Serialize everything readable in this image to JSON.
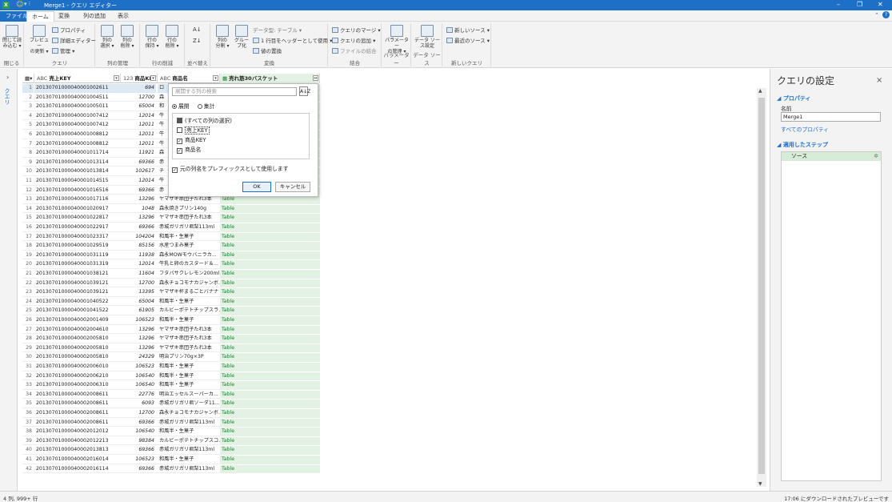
{
  "titlebar": {
    "app_logo": "X",
    "title": "Merge1 - クエリ エディター",
    "qa_text": "▾ ⁝"
  },
  "tabs": [
    "ファイル",
    "ホーム",
    "変換",
    "列の追加",
    "表示"
  ],
  "ribbon": {
    "close_load": "閉じて読\nみ込む ▾",
    "preview_refresh": "プレビュー\nの更新 ▾",
    "properties": "プロパティ",
    "advanced_editor": "詳細エディター",
    "manage": "管理 ▾",
    "query_group": "クエリ",
    "close_group": "閉じる",
    "choose_cols": "列の\n選択 ▾",
    "remove_cols": "列の\n削除 ▾",
    "manage_cols_group": "列の管理",
    "keep_rows": "行の\n保持 ▾",
    "remove_rows": "行の\n削除 ▾",
    "reduce_rows_group": "行の削減",
    "sort_group": "並べ替え",
    "split_col": "列の\n分割 ▾",
    "group_by": "グルー\nプ化",
    "datatype": "データ型: テーブル ▾",
    "first_row_header": "1 行目をヘッダーとして使用 ▾",
    "replace_values": "値の置換",
    "transform_group": "変換",
    "merge_queries": "クエリのマージ ▾",
    "append_queries": "クエリの追加 ▾",
    "combine_files": "ファイルの結合",
    "combine_group": "結合",
    "param_manage": "パラメーター\nの管理 ▾",
    "param_group": "パラメーター",
    "datasource_settings": "データ ソー\nス設定",
    "datasource_group": "データ ソース",
    "new_source": "新しいソース ▾",
    "recent_source": "最近のソース ▾",
    "new_query_group": "新しいクエリ"
  },
  "leftnav": {
    "chevron": "›",
    "label": "クエリ"
  },
  "grid": {
    "headers": [
      {
        "icon": "ABC",
        "label": "売上KEY"
      },
      {
        "icon": "123",
        "label": "商品KEY"
      },
      {
        "icon": "ABC",
        "label": "商品名"
      },
      {
        "icon": "▦",
        "label": "売れ筋30バスケット"
      }
    ],
    "rows": [
      {
        "n": "1",
        "key": "20130701000040001002611",
        "pk": "694",
        "name": "ロ",
        "tbl": ""
      },
      {
        "n": "2",
        "key": "20130701000040001004511",
        "pk": "12700",
        "name": "森",
        "tbl": ""
      },
      {
        "n": "3",
        "key": "20130701000040001005011",
        "pk": "65004",
        "name": "和",
        "tbl": ""
      },
      {
        "n": "4",
        "key": "20130701000040001007412",
        "pk": "12014",
        "name": "牛",
        "tbl": ""
      },
      {
        "n": "5",
        "key": "20130701000040001007412",
        "pk": "12011",
        "name": "牛",
        "tbl": ""
      },
      {
        "n": "6",
        "key": "20130701000040001008812",
        "pk": "12011",
        "name": "牛",
        "tbl": ""
      },
      {
        "n": "7",
        "key": "20130701000040001008812",
        "pk": "12011",
        "name": "牛",
        "tbl": ""
      },
      {
        "n": "8",
        "key": "20130701000040001011714",
        "pk": "11921",
        "name": "森",
        "tbl": ""
      },
      {
        "n": "9",
        "key": "20130701000040001013114",
        "pk": "69366",
        "name": "赤",
        "tbl": ""
      },
      {
        "n": "10",
        "key": "20130701000040001013814",
        "pk": "102617",
        "name": "チ",
        "tbl": ""
      },
      {
        "n": "11",
        "key": "20130701000040001014515",
        "pk": "12014",
        "name": "牛",
        "tbl": ""
      },
      {
        "n": "12",
        "key": "20130701000040001016516",
        "pk": "69366",
        "name": "赤",
        "tbl": ""
      },
      {
        "n": "13",
        "key": "20130701000040001017116",
        "pk": "13296",
        "name": "ヤマザキ串団子たれ3本",
        "tbl": "Table"
      },
      {
        "n": "14",
        "key": "20130701000040001020917",
        "pk": "1048",
        "name": "森永焼きプリン140g",
        "tbl": "Table"
      },
      {
        "n": "15",
        "key": "20130701000040001022817",
        "pk": "13296",
        "name": "ヤマザキ串団子たれ3本",
        "tbl": "Table"
      },
      {
        "n": "16",
        "key": "20130701000040001022917",
        "pk": "69366",
        "name": "赤城ガリガリ君梨113ml",
        "tbl": "Table"
      },
      {
        "n": "17",
        "key": "20130701000040001023317",
        "pk": "104204",
        "name": "和風半・生菓子",
        "tbl": "Table"
      },
      {
        "n": "18",
        "key": "20130701000040001029519",
        "pk": "85156",
        "name": "水産つまみ菓子",
        "tbl": "Table"
      },
      {
        "n": "19",
        "key": "20130701000040001031119",
        "pk": "11938",
        "name": "森永MOWモウバニラカ...",
        "tbl": "Table"
      },
      {
        "n": "20",
        "key": "20130701000040001031319",
        "pk": "12014",
        "name": "牛乳と卵のカスタード＆...",
        "tbl": "Table"
      },
      {
        "n": "21",
        "key": "20130701000040001038121",
        "pk": "11604",
        "name": "フタバサクレレモン200ml",
        "tbl": "Table"
      },
      {
        "n": "22",
        "key": "20130701000040001039121",
        "pk": "12700",
        "name": "森永チョコモナカジャンボ...",
        "tbl": "Table"
      },
      {
        "n": "23",
        "key": "20130701000040001039121",
        "pk": "13395",
        "name": "ヤマザキ杯まるごとバナナ",
        "tbl": "Table"
      },
      {
        "n": "24",
        "key": "20130701000040001040522",
        "pk": "65004",
        "name": "和風半・生菓子",
        "tbl": "Table"
      },
      {
        "n": "25",
        "key": "20130701000040001041522",
        "pk": "61905",
        "name": "カルビーポテトチップスラ...",
        "tbl": "Table"
      },
      {
        "n": "26",
        "key": "20130701000040002001409",
        "pk": "106523",
        "name": "和風半・生菓子",
        "tbl": "Table"
      },
      {
        "n": "27",
        "key": "20130701000040002004610",
        "pk": "13296",
        "name": "ヤマザキ串団子たれ3本",
        "tbl": "Table"
      },
      {
        "n": "28",
        "key": "20130701000040002005810",
        "pk": "13296",
        "name": "ヤマザキ串団子たれ3本",
        "tbl": "Table"
      },
      {
        "n": "29",
        "key": "20130701000040002005810",
        "pk": "13296",
        "name": "ヤマザキ串団子たれ3本",
        "tbl": "Table"
      },
      {
        "n": "30",
        "key": "20130701000040002005810",
        "pk": "24329",
        "name": "明治プリン70g×3P",
        "tbl": "Table"
      },
      {
        "n": "31",
        "key": "20130701000040002006010",
        "pk": "106523",
        "name": "和風半・生菓子",
        "tbl": "Table"
      },
      {
        "n": "32",
        "key": "20130701000040002006210",
        "pk": "106540",
        "name": "和風半・生菓子",
        "tbl": "Table"
      },
      {
        "n": "33",
        "key": "20130701000040002006310",
        "pk": "106540",
        "name": "和風半・生菓子",
        "tbl": "Table"
      },
      {
        "n": "34",
        "key": "20130701000040002008611",
        "pk": "22776",
        "name": "明治エッセルスーパーカ...",
        "tbl": "Table"
      },
      {
        "n": "35",
        "key": "20130701000040002008611",
        "pk": "6093",
        "name": "赤城ガリガリ君ソーダ11...",
        "tbl": "Table"
      },
      {
        "n": "36",
        "key": "20130701000040002008611",
        "pk": "12700",
        "name": "森永チョコモナカジャンボ...",
        "tbl": "Table"
      },
      {
        "n": "37",
        "key": "20130701000040002008611",
        "pk": "69366",
        "name": "赤城ガリガリ君梨113ml",
        "tbl": "Table"
      },
      {
        "n": "38",
        "key": "20130701000040002012012",
        "pk": "106540",
        "name": "和風半・生菓子",
        "tbl": "Table"
      },
      {
        "n": "39",
        "key": "20130701000040002012213",
        "pk": "98384",
        "name": "カルビーポテトチップスコ...",
        "tbl": "Table"
      },
      {
        "n": "40",
        "key": "20130701000040002013813",
        "pk": "69366",
        "name": "赤城ガリガリ君梨113ml",
        "tbl": "Table"
      },
      {
        "n": "41",
        "key": "20130701000040002016014",
        "pk": "106523",
        "name": "和風半・生菓子",
        "tbl": "Table"
      },
      {
        "n": "42",
        "key": "20130701000040002016114",
        "pk": "69366",
        "name": "赤城ガリガリ君梨113ml",
        "tbl": "Table"
      }
    ]
  },
  "popup": {
    "search_placeholder": "展開する列の検索",
    "sort_icon": "A↓Z",
    "expand": "展開",
    "aggregate": "集計",
    "select_all": "(すべての列の選択)",
    "items": [
      {
        "label": "売上KEY",
        "checked": false
      },
      {
        "label": "商品KEY",
        "checked": true
      },
      {
        "label": "商品名",
        "checked": true
      }
    ],
    "prefix": "元の列名をプレフィックスとして使用します",
    "ok": "OK",
    "cancel": "キャンセル"
  },
  "pane": {
    "title": "クエリの設定",
    "close": "×",
    "properties": "プロパティ",
    "name_label": "名前",
    "name_value": "Merge1",
    "all_properties": "すべてのプロパティ",
    "applied_steps": "適用したステップ",
    "steps": [
      "ソース"
    ]
  },
  "status": {
    "left": "4 列, 999+ 行",
    "right": "17:06 にダウンロードされたプレビューです"
  },
  "colors": {
    "accent": "#1e70c7",
    "table_link": "#1e7a2e",
    "table_cell_bg": "#e3f2e3"
  }
}
